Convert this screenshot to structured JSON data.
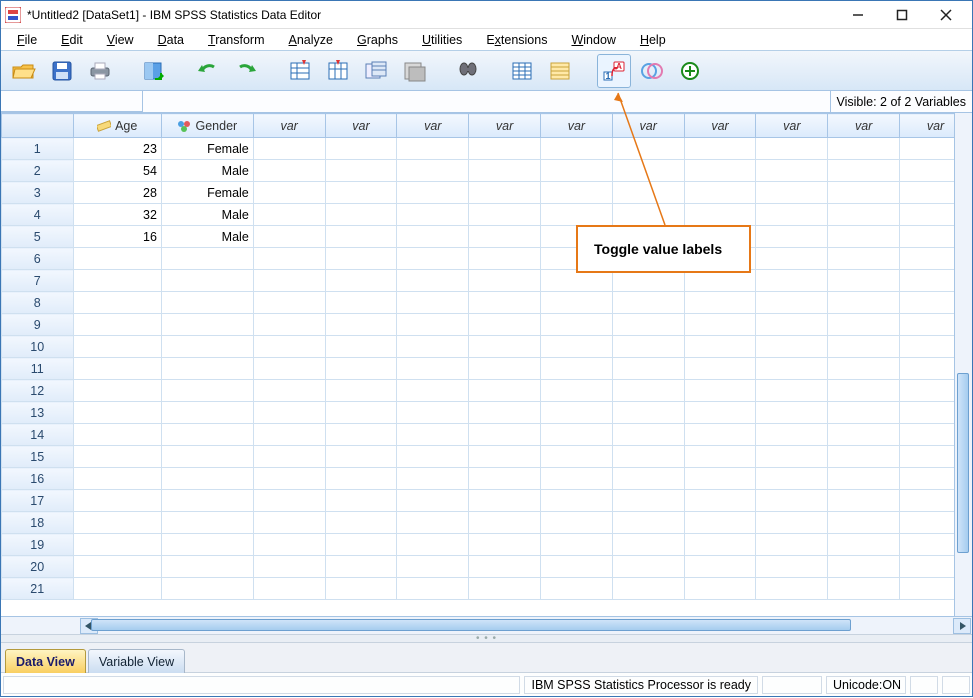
{
  "window": {
    "title": "*Untitled2 [DataSet1] - IBM SPSS Statistics Data Editor"
  },
  "menu": {
    "items": [
      "File",
      "Edit",
      "View",
      "Data",
      "Transform",
      "Analyze",
      "Graphs",
      "Utilities",
      "Extensions",
      "Window",
      "Help"
    ]
  },
  "toolbar_icons": [
    "open",
    "save",
    "print",
    "goto-variable",
    "undo",
    "redo",
    "insert-cases",
    "insert-variable",
    "split-file",
    "weight-cases",
    "select-cases",
    "find",
    "recode",
    "crosstabs",
    "value-labels",
    "use-sets",
    "add-variable"
  ],
  "infobar": {
    "visible_text": "Visible: 2 of 2 Variables"
  },
  "columns": {
    "age": "Age",
    "gender": "Gender",
    "placeholder": "var"
  },
  "rows": [
    {
      "n": 1,
      "age": 23,
      "gender": "Female"
    },
    {
      "n": 2,
      "age": 54,
      "gender": "Male"
    },
    {
      "n": 3,
      "age": 28,
      "gender": "Female"
    },
    {
      "n": 4,
      "age": 32,
      "gender": "Male"
    },
    {
      "n": 5,
      "age": 16,
      "gender": "Male"
    }
  ],
  "empty_row_count": 16,
  "tabs": {
    "data_view": "Data View",
    "variable_view": "Variable View"
  },
  "status": {
    "ready": "IBM SPSS Statistics Processor is ready",
    "unicode": "Unicode:ON"
  },
  "annotation": {
    "text": "Toggle value labels"
  },
  "winctrl": {
    "min": "—",
    "max": "▢",
    "close": "✕"
  }
}
